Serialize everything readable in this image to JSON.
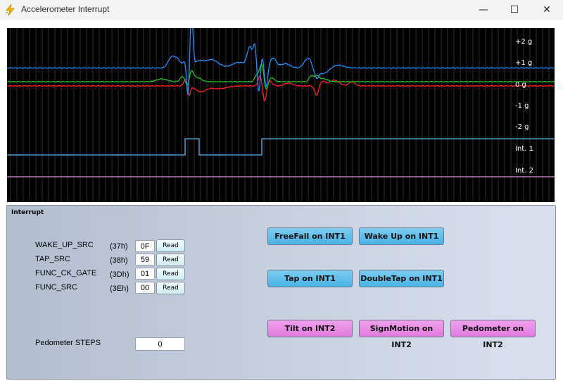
{
  "window": {
    "title": "Accelerometer Interrupt",
    "minimize_glyph": "—",
    "maximize_glyph": "☐",
    "close_glyph": "✕",
    "icon": "lightning-icon"
  },
  "plot": {
    "axis_labels": [
      "+2 g",
      "+1 g",
      "0 g",
      "-1 g",
      "-2 g"
    ],
    "channel_labels": [
      "Int. 1",
      "Int. 2"
    ],
    "colors": {
      "background": "#000000",
      "grid": "#2e2e2e",
      "x_axis": "#1e90ff",
      "y_axis": "#ff2020",
      "z_axis": "#20c020",
      "int1": "#5bb8f0",
      "int2": "#e48be4"
    }
  },
  "panel": {
    "title": "Interrupt",
    "registers": [
      {
        "name": "WAKE_UP_SRC",
        "addr": "(37h)",
        "value": "0F",
        "button": "Read"
      },
      {
        "name": "TAP_SRC",
        "addr": "(38h)",
        "value": "59",
        "button": "Read"
      },
      {
        "name": "FUNC_CK_GATE",
        "addr": "(3Dh)",
        "value": "01",
        "button": "Read"
      },
      {
        "name": "FUNC_SRC",
        "addr": "(3Eh)",
        "value": "00",
        "button": "Read"
      }
    ],
    "int1_buttons": [
      "FreeFall on INT1",
      "Wake Up on INT1",
      "Tap on INT1",
      "DoubleTap on INT1"
    ],
    "int2_buttons": [
      "Tilt on INT2",
      "SignMotion on INT2",
      "Pedometer on INT2"
    ],
    "pedometer": {
      "label": "Pedometer STEPS",
      "value": "0"
    }
  }
}
